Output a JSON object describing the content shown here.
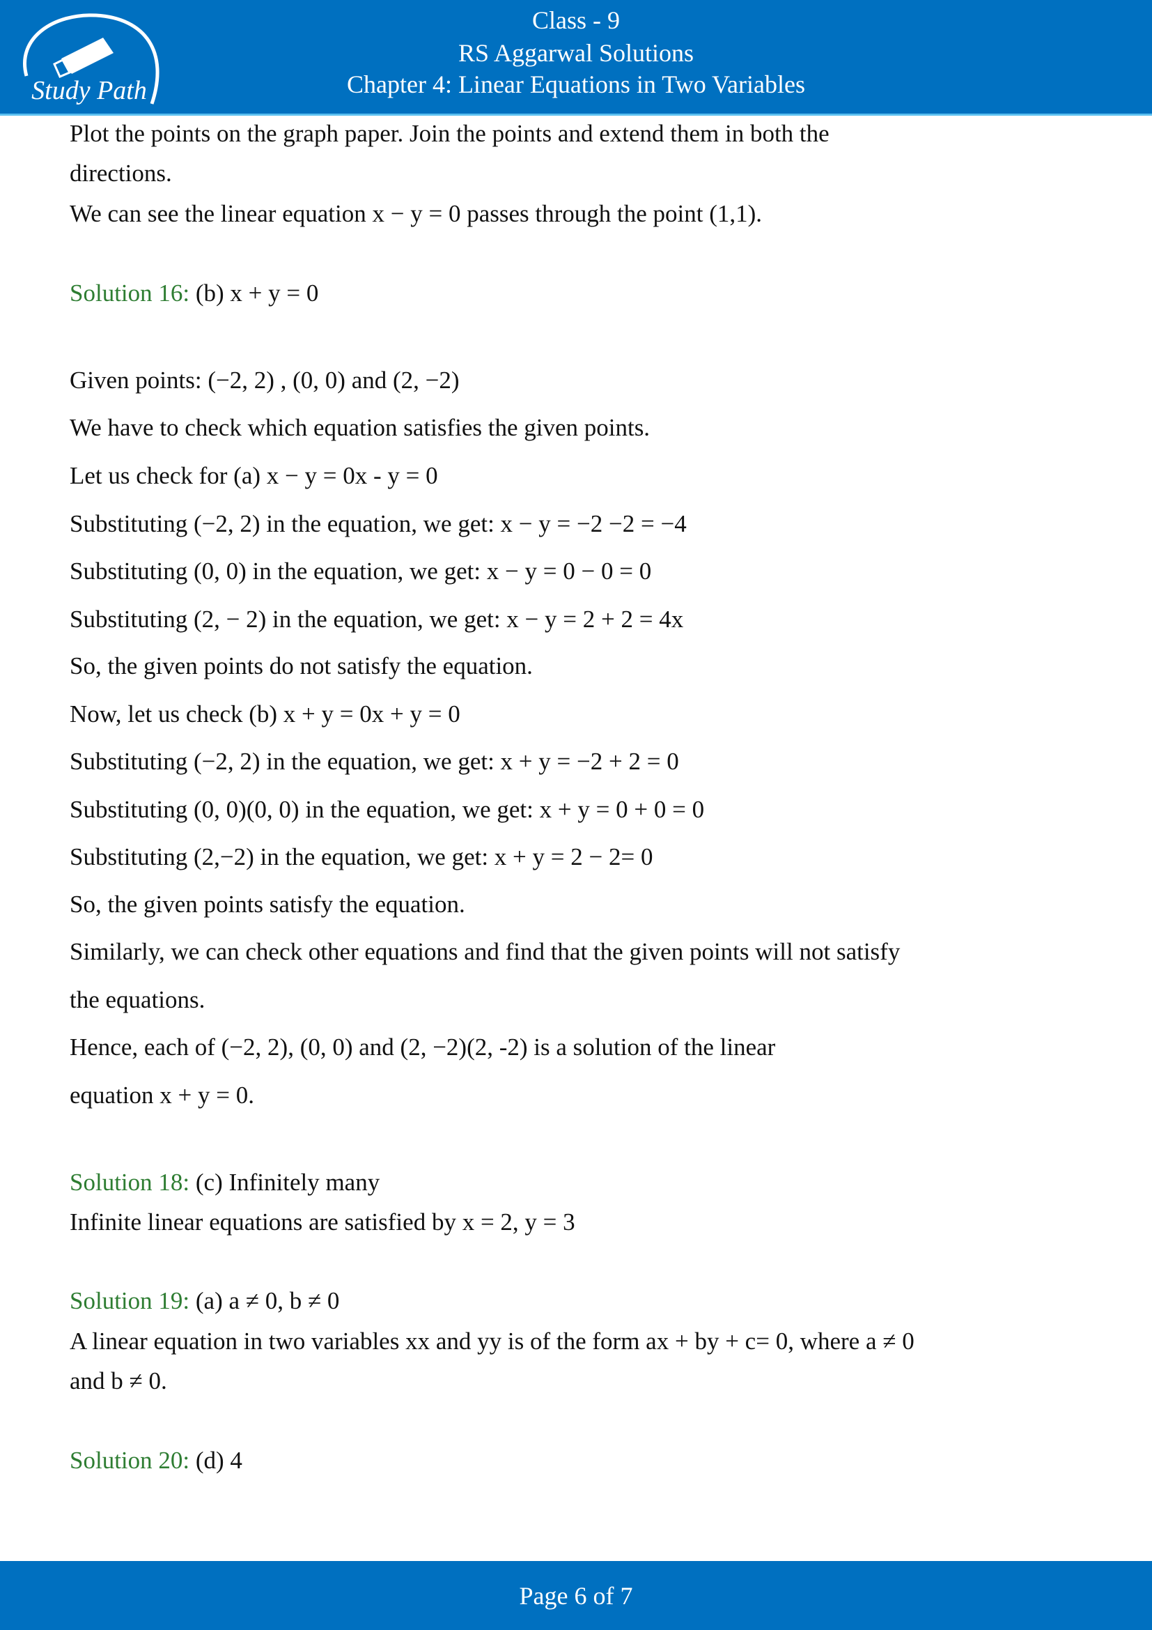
{
  "header": {
    "logo_text": "Study Path",
    "line1": "Class - 9",
    "line2": "RS Aggarwal Solutions",
    "line3": "Chapter 4: Linear Equations in Two Variables"
  },
  "lines": [
    "Plot the points on the graph paper. Join the points and extend them in both the",
    "directions.",
    "We can see the linear equation x − y = 0 passes through the point (1,1).",
    "Given points: (−2, 2) , (0, 0) and (2, −2)",
    "We have to check which equation satisfies the given points.",
    "Let us check for (a) x − y = 0x - y = 0",
    "Substituting (−2, 2) in the equation, we get: x − y = −2 −2 = −4",
    "Substituting (0, 0) in the equation, we get: x − y = 0 − 0 = 0",
    "Substituting (2, − 2) in the equation, we get: x − y = 2 + 2 = 4x",
    "So, the given points do not satisfy the equation.",
    "Now, let us check (b) x + y = 0x + y = 0",
    "Substituting (−2, 2) in the equation, we get: x + y = −2 + 2 = 0",
    "Substituting (0, 0)(0, 0) in the equation, we get: x + y = 0 + 0 = 0",
    "Substituting (2,−2) in the equation, we get:  x + y = 2 − 2= 0",
    "So, the given points satisfy the equation.",
    "Similarly, we can check other equations and find that the given points will not satisfy",
    "the equations.",
    "Hence, each of (−2, 2), (0, 0) and (2, −2)(2, -2) is a solution of the linear",
    "equation x + y = 0.",
    "Infinite linear equations are satisfied by x = 2, y = 3",
    "A linear equation in two variables xx and yy is of the form ax + by + c= 0, where a ≠ 0",
    "and b ≠ 0."
  ],
  "solutions": [
    {
      "label": "Solution 16:",
      "answer": " (b) x + y = 0"
    },
    {
      "label": "Solution 18:",
      "answer": " (c) Infinitely many"
    },
    {
      "label": "Solution 19:",
      "answer": " (a) a ≠ 0, b ≠ 0"
    },
    {
      "label": "Solution 20:",
      "answer": " (d) 4"
    }
  ],
  "footer": {
    "prefix": "Page ",
    "current": "6",
    "middle": " of ",
    "total": "7"
  },
  "colors": {
    "brand_blue": "#0070c0",
    "solution_green": "#2e7d32"
  }
}
